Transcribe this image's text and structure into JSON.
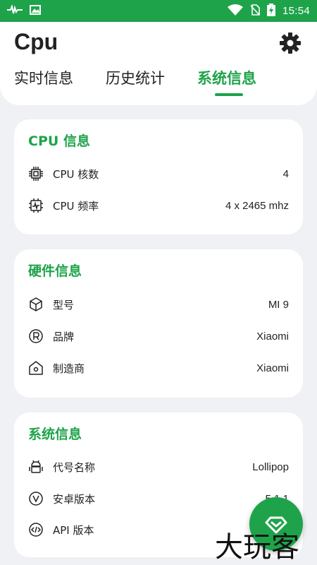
{
  "status_bar": {
    "time": "15:54",
    "icons": [
      "activity-icon",
      "image-icon",
      "wifi-icon",
      "no-sim-icon",
      "battery-charging-icon"
    ]
  },
  "header": {
    "title": "Cpu",
    "settings_icon": "gear-icon",
    "tabs": [
      {
        "label": "实时信息",
        "active": false
      },
      {
        "label": "历史统计",
        "active": false
      },
      {
        "label": "系统信息",
        "active": true
      }
    ]
  },
  "colors": {
    "accent": "#1ea34a",
    "background": "#eff1f4",
    "card": "#ffffff",
    "text": "#222222"
  },
  "cards": [
    {
      "title": "CPU 信息",
      "rows": [
        {
          "icon": "cpu-chip-icon",
          "label": "CPU 核数",
          "value": "4"
        },
        {
          "icon": "cpu-frequency-icon",
          "label": "CPU 频率",
          "value": "4 x 2465 mhz"
        }
      ]
    },
    {
      "title": "硬件信息",
      "rows": [
        {
          "icon": "cube-icon",
          "label": "型号",
          "value": "MI 9"
        },
        {
          "icon": "registered-icon",
          "label": "品牌",
          "value": "Xiaomi"
        },
        {
          "icon": "home-icon",
          "label": "制造商",
          "value": "Xiaomi"
        }
      ]
    },
    {
      "title": "系统信息",
      "rows": [
        {
          "icon": "android-icon",
          "label": "代号名称",
          "value": "Lollipop"
        },
        {
          "icon": "version-icon",
          "label": "安卓版本",
          "value": "5.1.1"
        },
        {
          "icon": "code-icon",
          "label": "API 版本",
          "value": ""
        }
      ]
    }
  ],
  "fab": {
    "icon": "diamond-icon"
  },
  "watermark": {
    "text": "大玩客"
  }
}
